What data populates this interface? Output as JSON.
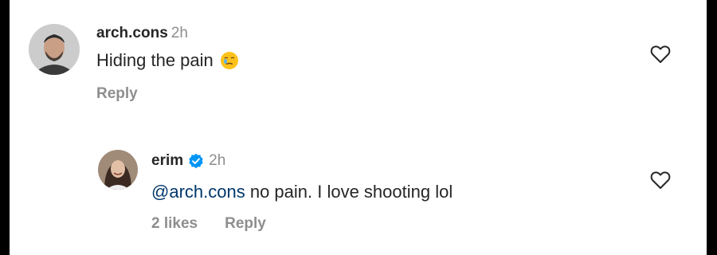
{
  "comments": [
    {
      "username": "arch.cons",
      "time": "2h",
      "text": "Hiding the pain",
      "emoji": "face-holding-back-tears",
      "reply_label": "Reply",
      "avatar_icon": "user-avatar-man"
    }
  ],
  "replies": [
    {
      "username": "erim",
      "verified": true,
      "time": "2h",
      "mention": "@arch.cons",
      "text": " no pain. I love shooting lol",
      "likes_label": "2 likes",
      "reply_label": "Reply",
      "avatar_icon": "user-avatar-woman"
    }
  ],
  "icons": {
    "like": "heart-icon",
    "verified": "verified-badge-icon"
  },
  "colors": {
    "primary_text": "#262626",
    "secondary_text": "#8e8e8e",
    "mention": "#00376b",
    "verified": "#0095f6",
    "background": "#ffffff"
  }
}
